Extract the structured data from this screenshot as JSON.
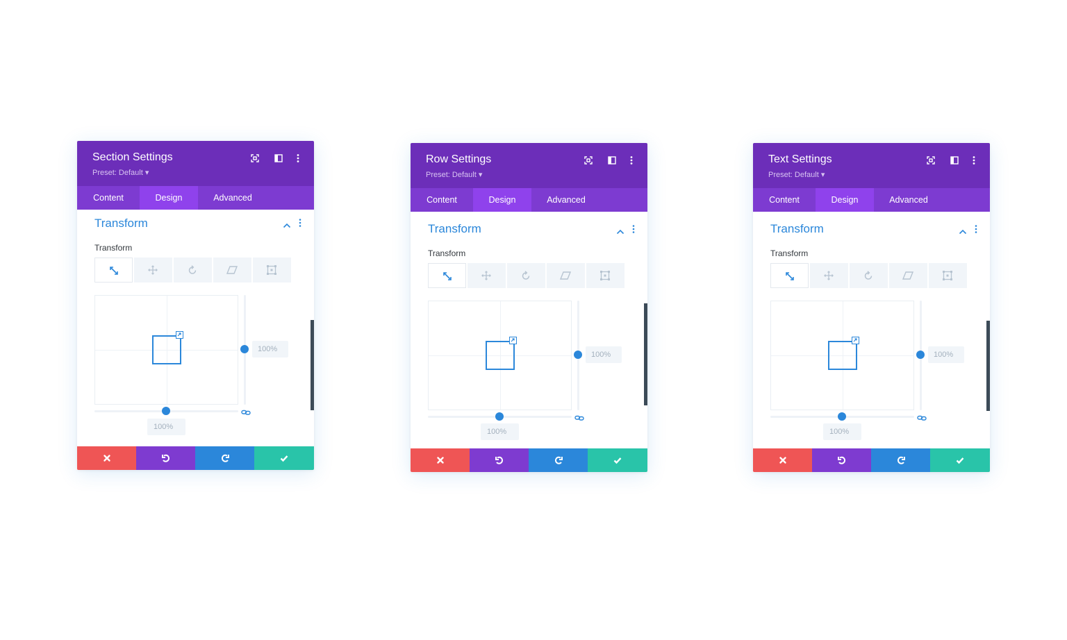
{
  "panels": [
    {
      "title": "Section Settings",
      "preset": "Preset: Default ▾",
      "tabs": [
        {
          "label": "Content"
        },
        {
          "label": "Design",
          "active": true
        },
        {
          "label": "Advanced"
        }
      ],
      "section_title": "Transform",
      "field_label": "Transform",
      "transform_tabs": [
        "scale-icon",
        "translate-icon",
        "rotate-icon",
        "skew-icon",
        "origin-icon"
      ],
      "active_transform_tab": "scale",
      "scale_y_value": "100%",
      "scale_x_value": "100%"
    },
    {
      "title": "Row Settings",
      "preset": "Preset: Default ▾",
      "tabs": [
        {
          "label": "Content"
        },
        {
          "label": "Design",
          "active": true
        },
        {
          "label": "Advanced"
        }
      ],
      "section_title": "Transform",
      "field_label": "Transform",
      "transform_tabs": [
        "scale-icon",
        "translate-icon",
        "rotate-icon",
        "skew-icon",
        "origin-icon"
      ],
      "active_transform_tab": "scale",
      "scale_y_value": "100%",
      "scale_x_value": "100%"
    },
    {
      "title": "Text Settings",
      "preset": "Preset: Default ▾",
      "tabs": [
        {
          "label": "Content"
        },
        {
          "label": "Design",
          "active": true
        },
        {
          "label": "Advanced"
        }
      ],
      "section_title": "Transform",
      "field_label": "Transform",
      "transform_tabs": [
        "scale-icon",
        "translate-icon",
        "rotate-icon",
        "skew-icon",
        "origin-icon"
      ],
      "active_transform_tab": "scale",
      "scale_y_value": "100%",
      "scale_x_value": "100%"
    }
  ],
  "colors": {
    "header": "#6c2eb9",
    "tabs_bar": "#7d3bd1",
    "tab_active": "#8f42ec",
    "accent_blue": "#2b87da",
    "discard": "#ef5555",
    "undo": "#7e3bd0",
    "redo": "#2b87da",
    "save": "#29c4a9"
  },
  "footer_icons": [
    "close-icon",
    "undo-icon",
    "redo-icon",
    "check-icon"
  ]
}
